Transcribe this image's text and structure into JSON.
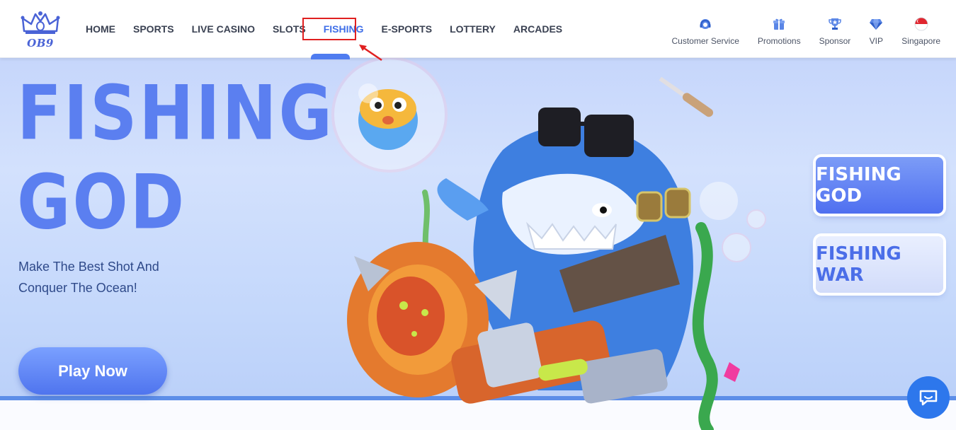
{
  "brand": {
    "logo_text": "OB9"
  },
  "nav": {
    "items": [
      {
        "label": "HOME"
      },
      {
        "label": "SPORTS"
      },
      {
        "label": "LIVE CASINO"
      },
      {
        "label": "SLOTS"
      },
      {
        "label": "FISHING",
        "active": true
      },
      {
        "label": "E-SPORTS"
      },
      {
        "label": "LOTTERY"
      },
      {
        "label": "ARCADES"
      }
    ]
  },
  "utilities": [
    {
      "label": "Customer Service",
      "icon": "headset-icon"
    },
    {
      "label": "Promotions",
      "icon": "gift-icon"
    },
    {
      "label": "Sponsor",
      "icon": "trophy-icon"
    },
    {
      "label": "VIP",
      "icon": "diamond-icon"
    },
    {
      "label": "Singapore",
      "icon": "singapore-flag-icon"
    }
  ],
  "hero": {
    "title_line1": "FISHING",
    "title_line2": "GOD",
    "subtitle": "Make The Best Shot And Conquer The Ocean!",
    "cta_label": "Play Now"
  },
  "game_selector": {
    "items": [
      {
        "label": "FISHING GOD",
        "selected": true
      },
      {
        "label": "FISHING WAR",
        "selected": false
      }
    ]
  },
  "colors": {
    "accent": "#3f6fe8",
    "title": "#5b7ff0",
    "annotation": "#e02020",
    "chat": "#2d77ec"
  }
}
